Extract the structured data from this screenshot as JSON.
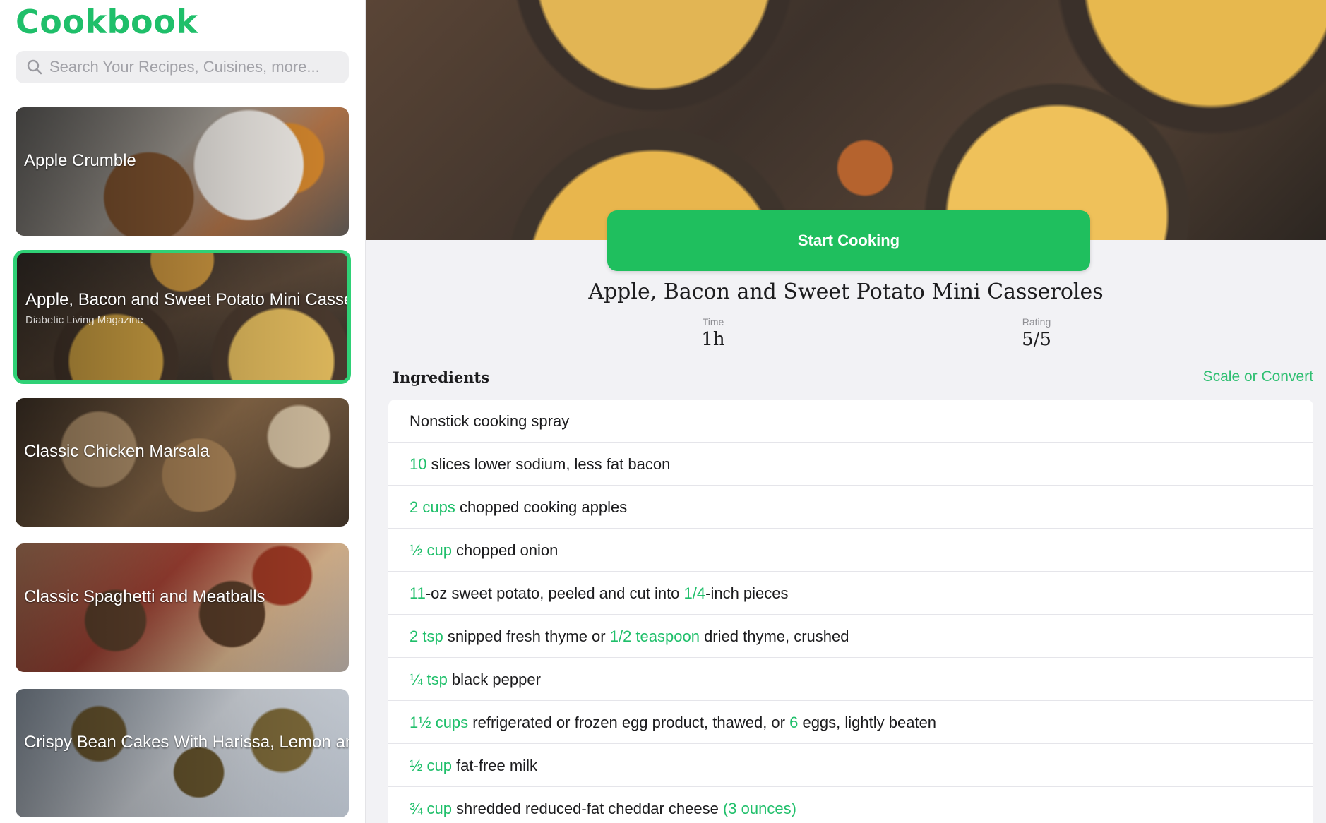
{
  "app": {
    "title": "Cookbook"
  },
  "search": {
    "placeholder": "Search Your Recipes, Cuisines, more..."
  },
  "recipes": [
    {
      "title": "Apple Crumble",
      "subtitle": "",
      "subtitle2": ""
    },
    {
      "title": "Apple, Bacon and Sweet Potato Mini Casseroles",
      "subtitle": "Diabetic Living Magazine",
      "subtitle2": "",
      "selected": true
    },
    {
      "title": "Classic Chicken Marsala",
      "subtitle": "",
      "subtitle2": ""
    },
    {
      "title": "Classic Spaghetti and Meatballs",
      "subtitle": "",
      "subtitle2": ""
    },
    {
      "title": "Crispy Bean Cakes With Harissa, Lemon and",
      "subtitle": "",
      "subtitle2": ""
    }
  ],
  "detail": {
    "start_label": "Start Cooking",
    "title": "Apple, Bacon and Sweet Potato Mini Casseroles",
    "time_label": "Time",
    "time_value": "1h",
    "rating_label": "Rating",
    "rating_value": "5/5",
    "ingredients_header": "Ingredients",
    "scale_label": "Scale or Convert"
  },
  "ingredients": [
    [
      {
        "t": "Nonstick cooking spray"
      }
    ],
    [
      {
        "t": "10",
        "q": true
      },
      {
        "t": " slices lower sodium, less fat bacon"
      }
    ],
    [
      {
        "t": "2 cups",
        "q": true
      },
      {
        "t": " chopped cooking apples"
      }
    ],
    [
      {
        "t": "½ cup",
        "q": true
      },
      {
        "t": " chopped onion"
      }
    ],
    [
      {
        "t": "11",
        "q": true
      },
      {
        "t": "-oz sweet potato, peeled and cut into "
      },
      {
        "t": "1/4",
        "q": true
      },
      {
        "t": "-inch pieces"
      }
    ],
    [
      {
        "t": "2 tsp",
        "q": true
      },
      {
        "t": " snipped fresh thyme or "
      },
      {
        "t": "1/2 teaspoon",
        "q": true
      },
      {
        "t": " dried thyme, crushed"
      }
    ],
    [
      {
        "t": "¼ tsp",
        "q": true
      },
      {
        "t": " black pepper"
      }
    ],
    [
      {
        "t": "1½ cups",
        "q": true
      },
      {
        "t": " refrigerated or frozen egg product, thawed, or "
      },
      {
        "t": "6",
        "q": true
      },
      {
        "t": " eggs, lightly beaten"
      }
    ],
    [
      {
        "t": "½ cup",
        "q": true
      },
      {
        "t": " fat-free milk"
      }
    ],
    [
      {
        "t": "¾ cup",
        "q": true
      },
      {
        "t": " shredded reduced-fat cheddar cheese "
      },
      {
        "t": "(3 ounces)",
        "q": true
      }
    ]
  ],
  "colors": {
    "accent": "#1fbf6a",
    "button": "#1fbf5e",
    "selected_border": "#2fd176"
  }
}
